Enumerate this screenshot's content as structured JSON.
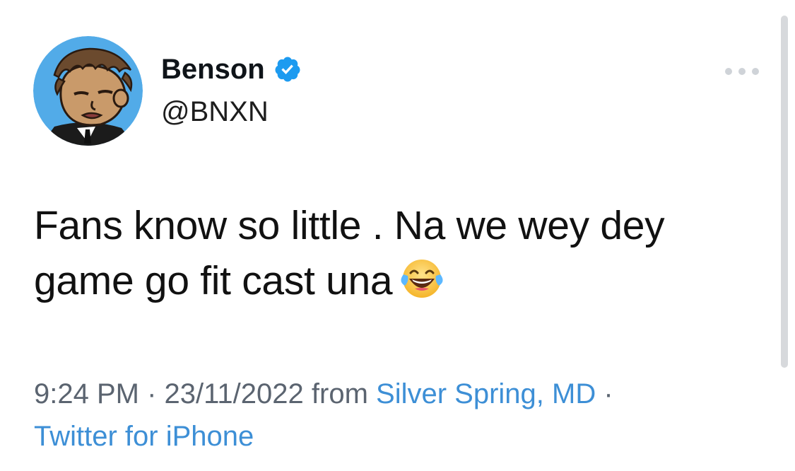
{
  "user": {
    "display_name": "Benson",
    "handle": "@BNXN",
    "verified": true,
    "avatar_icon": "cartoon-avatar"
  },
  "tweet": {
    "text": "Fans know so little . Na we wey dey game go fit cast una",
    "emoji": "face-with-tears-of-joy-icon",
    "time": "9:24 PM",
    "date": "23/11/2022",
    "from_label": "from",
    "location": "Silver Spring, MD",
    "separator": "·",
    "source": "Twitter for iPhone"
  },
  "colors": {
    "link": "#3d8fd6",
    "verified_badge": "#1d9bf0",
    "text": "#111111",
    "meta": "#5b6470",
    "avatar_bg": "#52abe8"
  },
  "icons": {
    "more": "more-options-icon",
    "verified": "verified-badge-icon"
  }
}
